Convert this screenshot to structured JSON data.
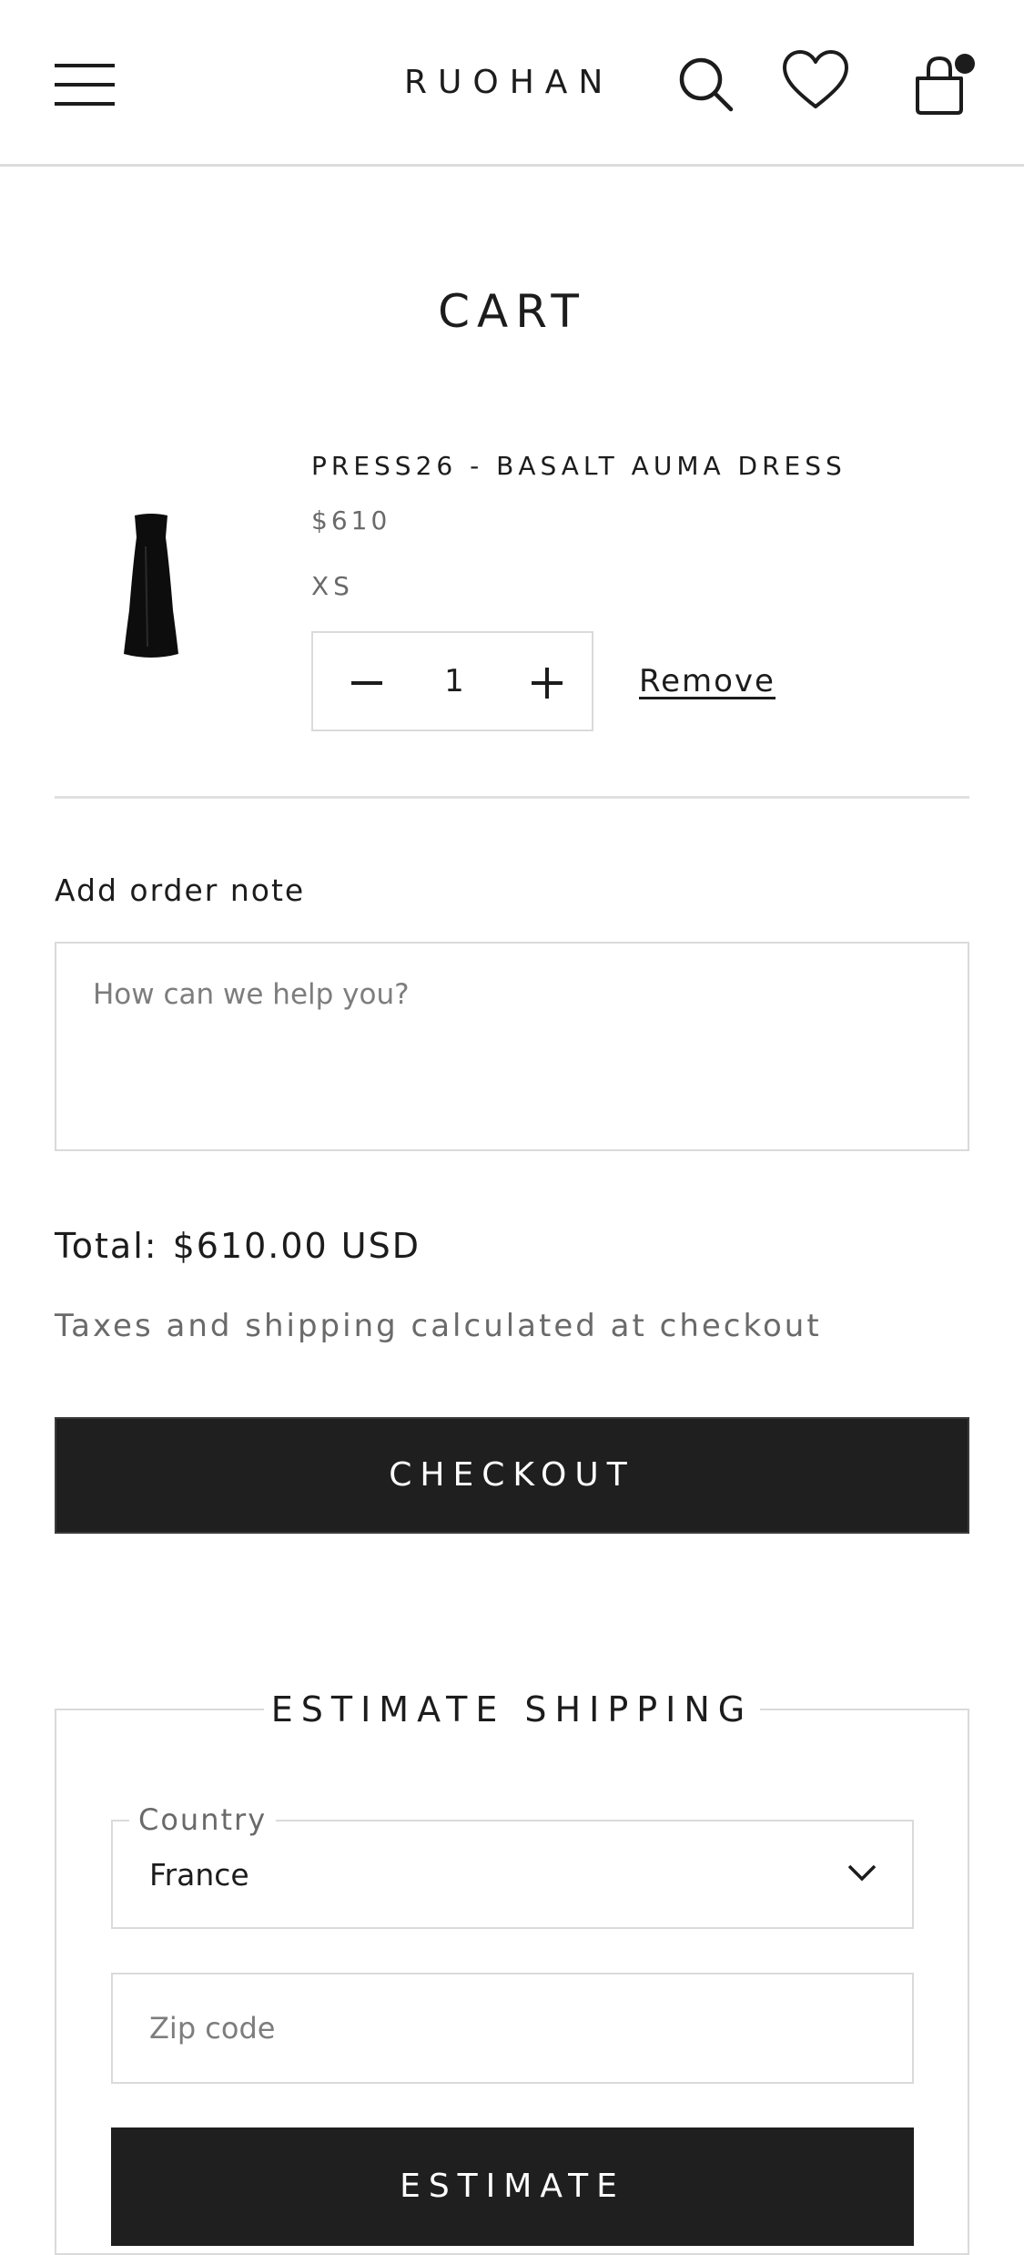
{
  "header": {
    "brand": "RUOHAN",
    "icons": [
      "menu-icon",
      "search-icon",
      "heart-icon",
      "bag-icon"
    ],
    "cart_has_items_dot": true
  },
  "cart": {
    "title": "CART",
    "item": {
      "name": "PRESS26 - BASALT AUMA DRESS",
      "price": "$610",
      "size": "XS",
      "quantity": "1",
      "remove_label": "Remove"
    }
  },
  "order_note": {
    "label": "Add order note",
    "placeholder": "How can we help you?"
  },
  "summary": {
    "total_label": "Total:",
    "total_value": "$610.00 USD",
    "tax_note": "Taxes and shipping calculated at checkout",
    "checkout_label": "CHECKOUT"
  },
  "shipping": {
    "title": "ESTIMATE SHIPPING",
    "country_label": "Country",
    "country_value": "France",
    "zip_placeholder": "Zip code",
    "estimate_label": "ESTIMATE"
  },
  "colors": {
    "text": "#1c1c1c",
    "muted": "#6a6a6a",
    "border": "#dadada",
    "button_bg": "#1f1f1f",
    "button_text": "#ffffff"
  }
}
